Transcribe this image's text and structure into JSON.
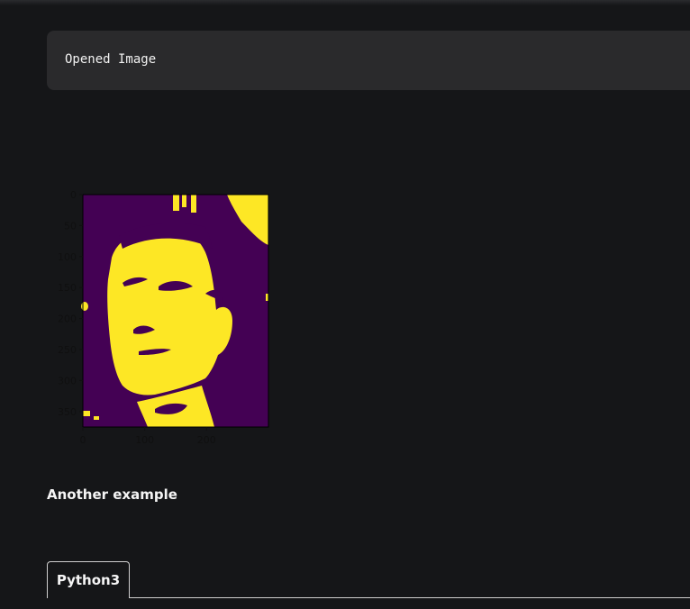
{
  "output": {
    "text": "Opened Image"
  },
  "plot": {
    "colors": {
      "background_value": "#440154",
      "foreground_value": "#fde725"
    }
  },
  "chart_data": {
    "type": "heatmap",
    "title": "",
    "xlabel": "",
    "ylabel": "",
    "xlim": [
      0,
      300
    ],
    "ylim": [
      375,
      0
    ],
    "x_ticks": [
      "0",
      "100",
      "200"
    ],
    "y_ticks": [
      "0",
      "50",
      "100",
      "150",
      "200",
      "250",
      "300",
      "350"
    ],
    "colormap": "viridis (binary)",
    "description_values": [
      0,
      1
    ]
  },
  "section": {
    "heading": "Another example"
  },
  "tabs": [
    {
      "label": "Python3"
    }
  ]
}
